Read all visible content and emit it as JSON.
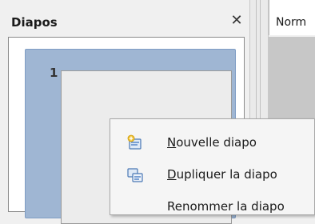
{
  "slides_panel": {
    "title": "Diapos",
    "close_glyph": "✕",
    "slides": [
      {
        "number": "1",
        "selected": true
      }
    ]
  },
  "editor": {
    "active_tab": "Norm"
  },
  "context_menu": {
    "items": [
      {
        "mnemonic": "N",
        "rest": "ouvelle diapo",
        "icon": "new-slide-icon"
      },
      {
        "mnemonic": "D",
        "rest": "upliquer la diapo",
        "icon": "duplicate-slide-icon"
      },
      {
        "mnemonic": "",
        "rest": "Renommer la diapo",
        "icon": ""
      }
    ]
  },
  "colors": {
    "selection": "#9fb6d3",
    "workspace": "#c7c7c7"
  }
}
